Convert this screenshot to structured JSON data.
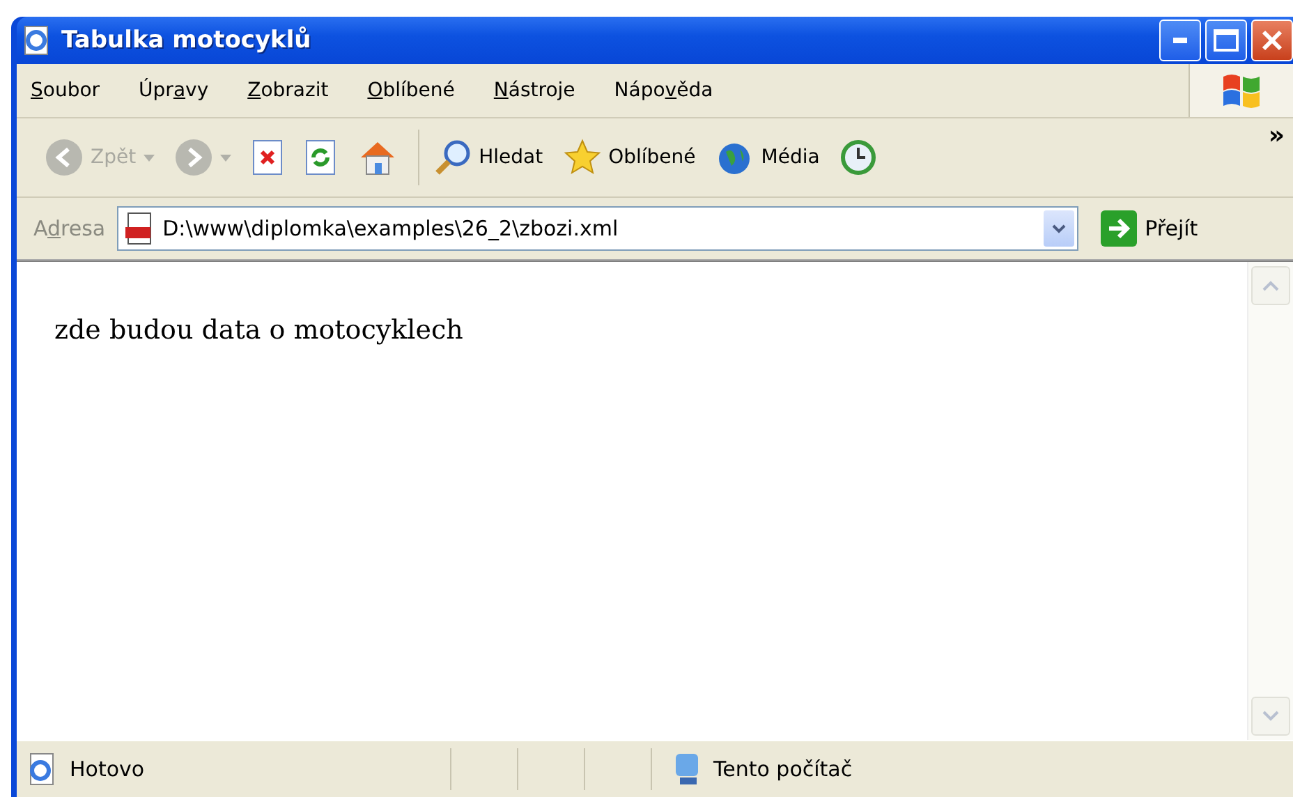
{
  "window": {
    "title": "Tabulka motocyklů"
  },
  "menu": [
    {
      "key": "S",
      "after": "oubor"
    },
    {
      "before": "Úpr",
      "key": "a",
      "after": "vy"
    },
    {
      "key": "Z",
      "after": "obrazit"
    },
    {
      "key": "O",
      "after": "blíbené"
    },
    {
      "key": "N",
      "after": "ástroje"
    },
    {
      "before": "Nápo",
      "key": "v",
      "after": "ěda"
    }
  ],
  "toolbar": [
    {
      "kind": "back",
      "label": "Zpět",
      "disabled": true
    },
    {
      "kind": "forward",
      "disabled": true
    },
    {
      "kind": "stop"
    },
    {
      "kind": "refresh"
    },
    {
      "kind": "home"
    },
    {
      "kind": "separator"
    },
    {
      "kind": "search",
      "label": "Hledat"
    },
    {
      "kind": "favorites",
      "label": "Oblíbené"
    },
    {
      "kind": "media",
      "label": "Média"
    },
    {
      "kind": "history"
    }
  ],
  "toolbar_more": "»",
  "address": {
    "label_parts": [
      "A",
      "d",
      "resa"
    ],
    "value": "D:\\www\\diplomka\\examples\\26_2\\zbozi.xml",
    "go": "Přejít"
  },
  "content": {
    "text": "zde budou data o motocyklech"
  },
  "status_bar": {
    "status": "Hotovo",
    "zone": "Tento počítač"
  }
}
